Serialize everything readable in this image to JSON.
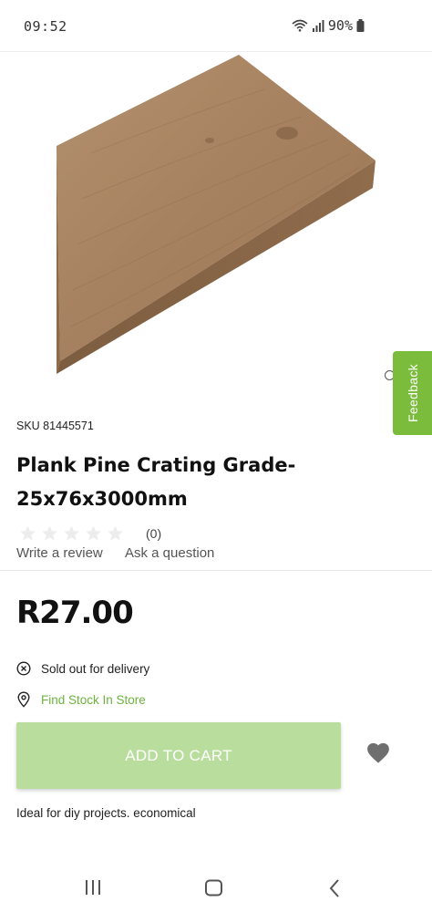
{
  "status_bar": {
    "time": "09:52",
    "battery": "90%"
  },
  "feedback": {
    "label": "Feedback"
  },
  "product": {
    "sku": "SKU 81445571",
    "title_line1": "Plank Pine Crating Grade-",
    "title_line2": "25x76x3000mm",
    "rating": 0,
    "review_count": "(0)",
    "write_review": "Write a review",
    "ask_question": "Ask a question",
    "price": "R27.00",
    "availability": "Sold out for delivery",
    "find_stock": "Find Stock In Store",
    "add_to_cart": "ADD TO CART",
    "description": "Ideal for diy projects. economical"
  },
  "colors": {
    "accent_green": "#7cbc3c",
    "button_disabled": "#b9dd9c",
    "link_green": "#6db33f"
  },
  "icons": {
    "wifi": "wifi-icon",
    "signal": "signal-icon",
    "battery": "battery-icon",
    "availability": "circle-x-icon",
    "location": "location-pin-icon",
    "wishlist": "heart-icon",
    "nav_recent": "recent-apps-icon",
    "nav_home": "home-icon",
    "nav_back": "back-icon"
  }
}
